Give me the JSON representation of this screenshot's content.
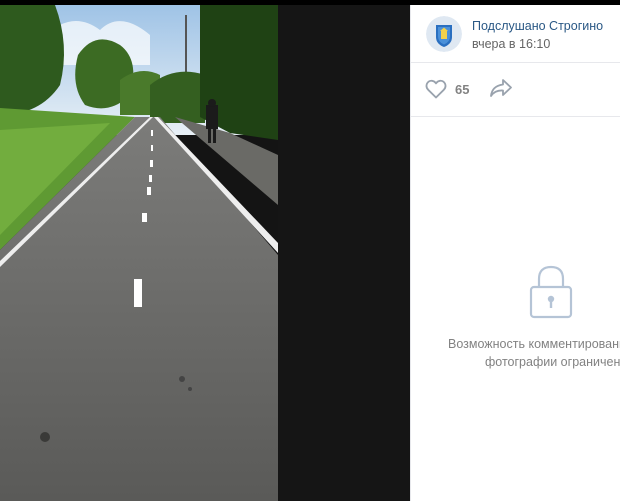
{
  "post": {
    "author": "Подслушано Строгино",
    "time": "вчера в 16:10"
  },
  "actions": {
    "likes": "65"
  },
  "comments": {
    "restricted_line1": "Возможность комментировани",
    "restricted_line2": "фотографии ограничена."
  },
  "icons": {
    "like": "heart-icon",
    "share": "share-arrow-icon",
    "lock": "lock-icon"
  },
  "colors": {
    "author_link": "#2a5885",
    "muted_text": "#828282",
    "icon_blue": "#b5c4d6"
  }
}
